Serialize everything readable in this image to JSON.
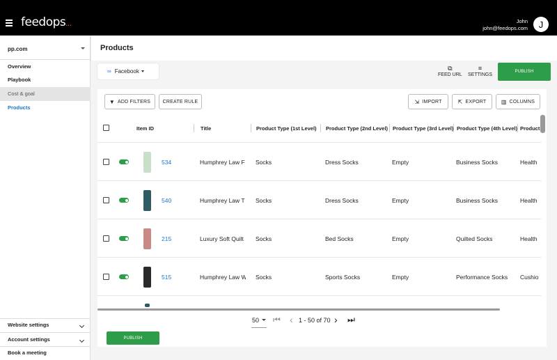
{
  "topbar": {
    "logo": "feedops",
    "logo_dots": "...",
    "user_name": "John",
    "user_email": "john@feedops.com",
    "avatar_initial": "J"
  },
  "sidebar": {
    "site": "pp.com",
    "items": [
      {
        "label": "Overview"
      },
      {
        "label": "Playbook"
      },
      {
        "label": "Cost & goal"
      },
      {
        "label": "Products"
      }
    ],
    "bottom": [
      {
        "label": "Website settings"
      },
      {
        "label": "Account settings"
      },
      {
        "label": "Book a meeting"
      }
    ]
  },
  "header": {
    "title": "Products"
  },
  "channel": {
    "label": "Facebook",
    "icon": "meta-icon"
  },
  "toolbar": {
    "feed_url": "FEED URL",
    "settings": "SETTINGS",
    "publish": "PUBLISH"
  },
  "actions": {
    "add_filters": "ADD FILTERS",
    "create_rule": "CREATE RULE",
    "import": "IMPORT",
    "export": "EXPORT",
    "columns": "COLUMNS"
  },
  "table": {
    "columns": [
      "Item ID",
      "Title",
      "Product Type (1st Level)",
      "Product Type (2nd Level)",
      "Product Type (3rd Level)",
      "Product Type (4th Level)",
      "Product"
    ],
    "rows": [
      {
        "id": "534",
        "title": "Humphrey Law F",
        "pt1": "Socks",
        "pt2": "Dress Socks",
        "pt3": "Empty",
        "pt4": "Business Socks",
        "pt5": "Health",
        "enabled": true,
        "thumb_color": "#c8e0c8"
      },
      {
        "id": "540",
        "title": "Humphrey Law T",
        "pt1": "Socks",
        "pt2": "Dress Socks",
        "pt3": "Empty",
        "pt4": "Business Socks",
        "pt5": "Health",
        "enabled": true,
        "thumb_color": "#2f5a66"
      },
      {
        "id": "215",
        "title": "Luxury Soft Quilt",
        "pt1": "Socks",
        "pt2": "Bed Socks",
        "pt3": "Empty",
        "pt4": "Quilted Socks",
        "pt5": "Health",
        "enabled": true,
        "thumb_color": "#c98a86"
      },
      {
        "id": "515",
        "title": "Humphrey Law W",
        "pt1": "Socks",
        "pt2": "Sports Socks",
        "pt3": "Empty",
        "pt4": "Performance Socks",
        "pt5": "Cushio",
        "enabled": true,
        "thumb_color": "#2a2a2a"
      }
    ]
  },
  "pagination": {
    "page_size": "50",
    "range": "1 - 50 of 70"
  },
  "footer": {
    "publish": "PUBLISH"
  }
}
